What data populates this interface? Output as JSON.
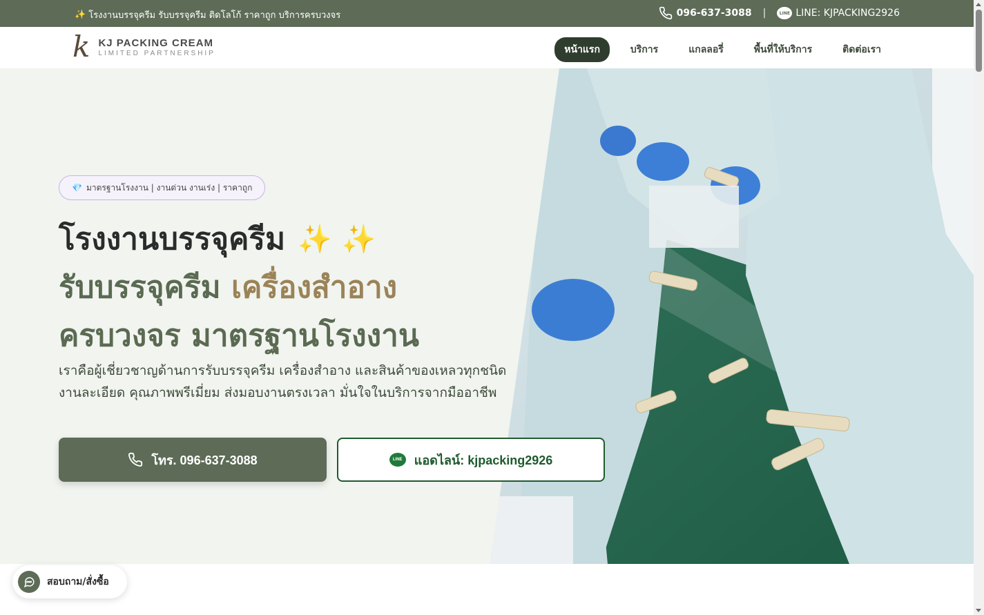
{
  "topbar": {
    "promo_icon": "✨",
    "promo": "โรงงานบรรจุครีม รับบรรจุครีม ติดโลโก้ ราคาถูก บริการครบวงจร",
    "phone": "096-637-3088",
    "separator": "|",
    "line_icon_text": "LINE",
    "line": "LINE: KJPACKING2926"
  },
  "header": {
    "logo_mark": "k",
    "logo_line1": "KJ PACKING CREAM",
    "logo_line2": "LIMITED PARTNERSHIP",
    "nav": [
      "หน้าแรก",
      "บริการ",
      "แกลลอรี่",
      "พื้นที่ให้บริการ",
      "ติดต่อเรา"
    ]
  },
  "hero": {
    "badge_icon": "💎",
    "badge": "มาตรฐานโรงงาน | งานด่วน งานเร่ง | ราคาถูก",
    "line1": "โรงงานบรรจุครีม",
    "sparkles": "✨ ✨",
    "line2_a": "รับบรรจุครีม",
    "line2_b": "เครื่องสำอาง",
    "line3": "ครบวงจร มาตรฐานโรงงาน",
    "desc1": "เราคือผู้เชี่ยวชาญด้านการรับบรรจุครีม เครื่องสำอาง และสินค้าของเหลวทุกชนิด",
    "desc2": "งานละเอียด คุณภาพพรีเมี่ยม ส่งมอบงานตรงเวลา มั่นใจในบริการจากมืออาชีพ",
    "btn_call": "โทร. 096-637-3088",
    "btn_line": "แอดไลน์: kjpacking2926",
    "line_icon_text": "LINE"
  },
  "chat": {
    "label": "สอบถาม/สั่งซื้อ"
  },
  "colors": {
    "brand": "#5d6b57",
    "accent": "#9b8358",
    "line_green": "#1f5a2e"
  }
}
